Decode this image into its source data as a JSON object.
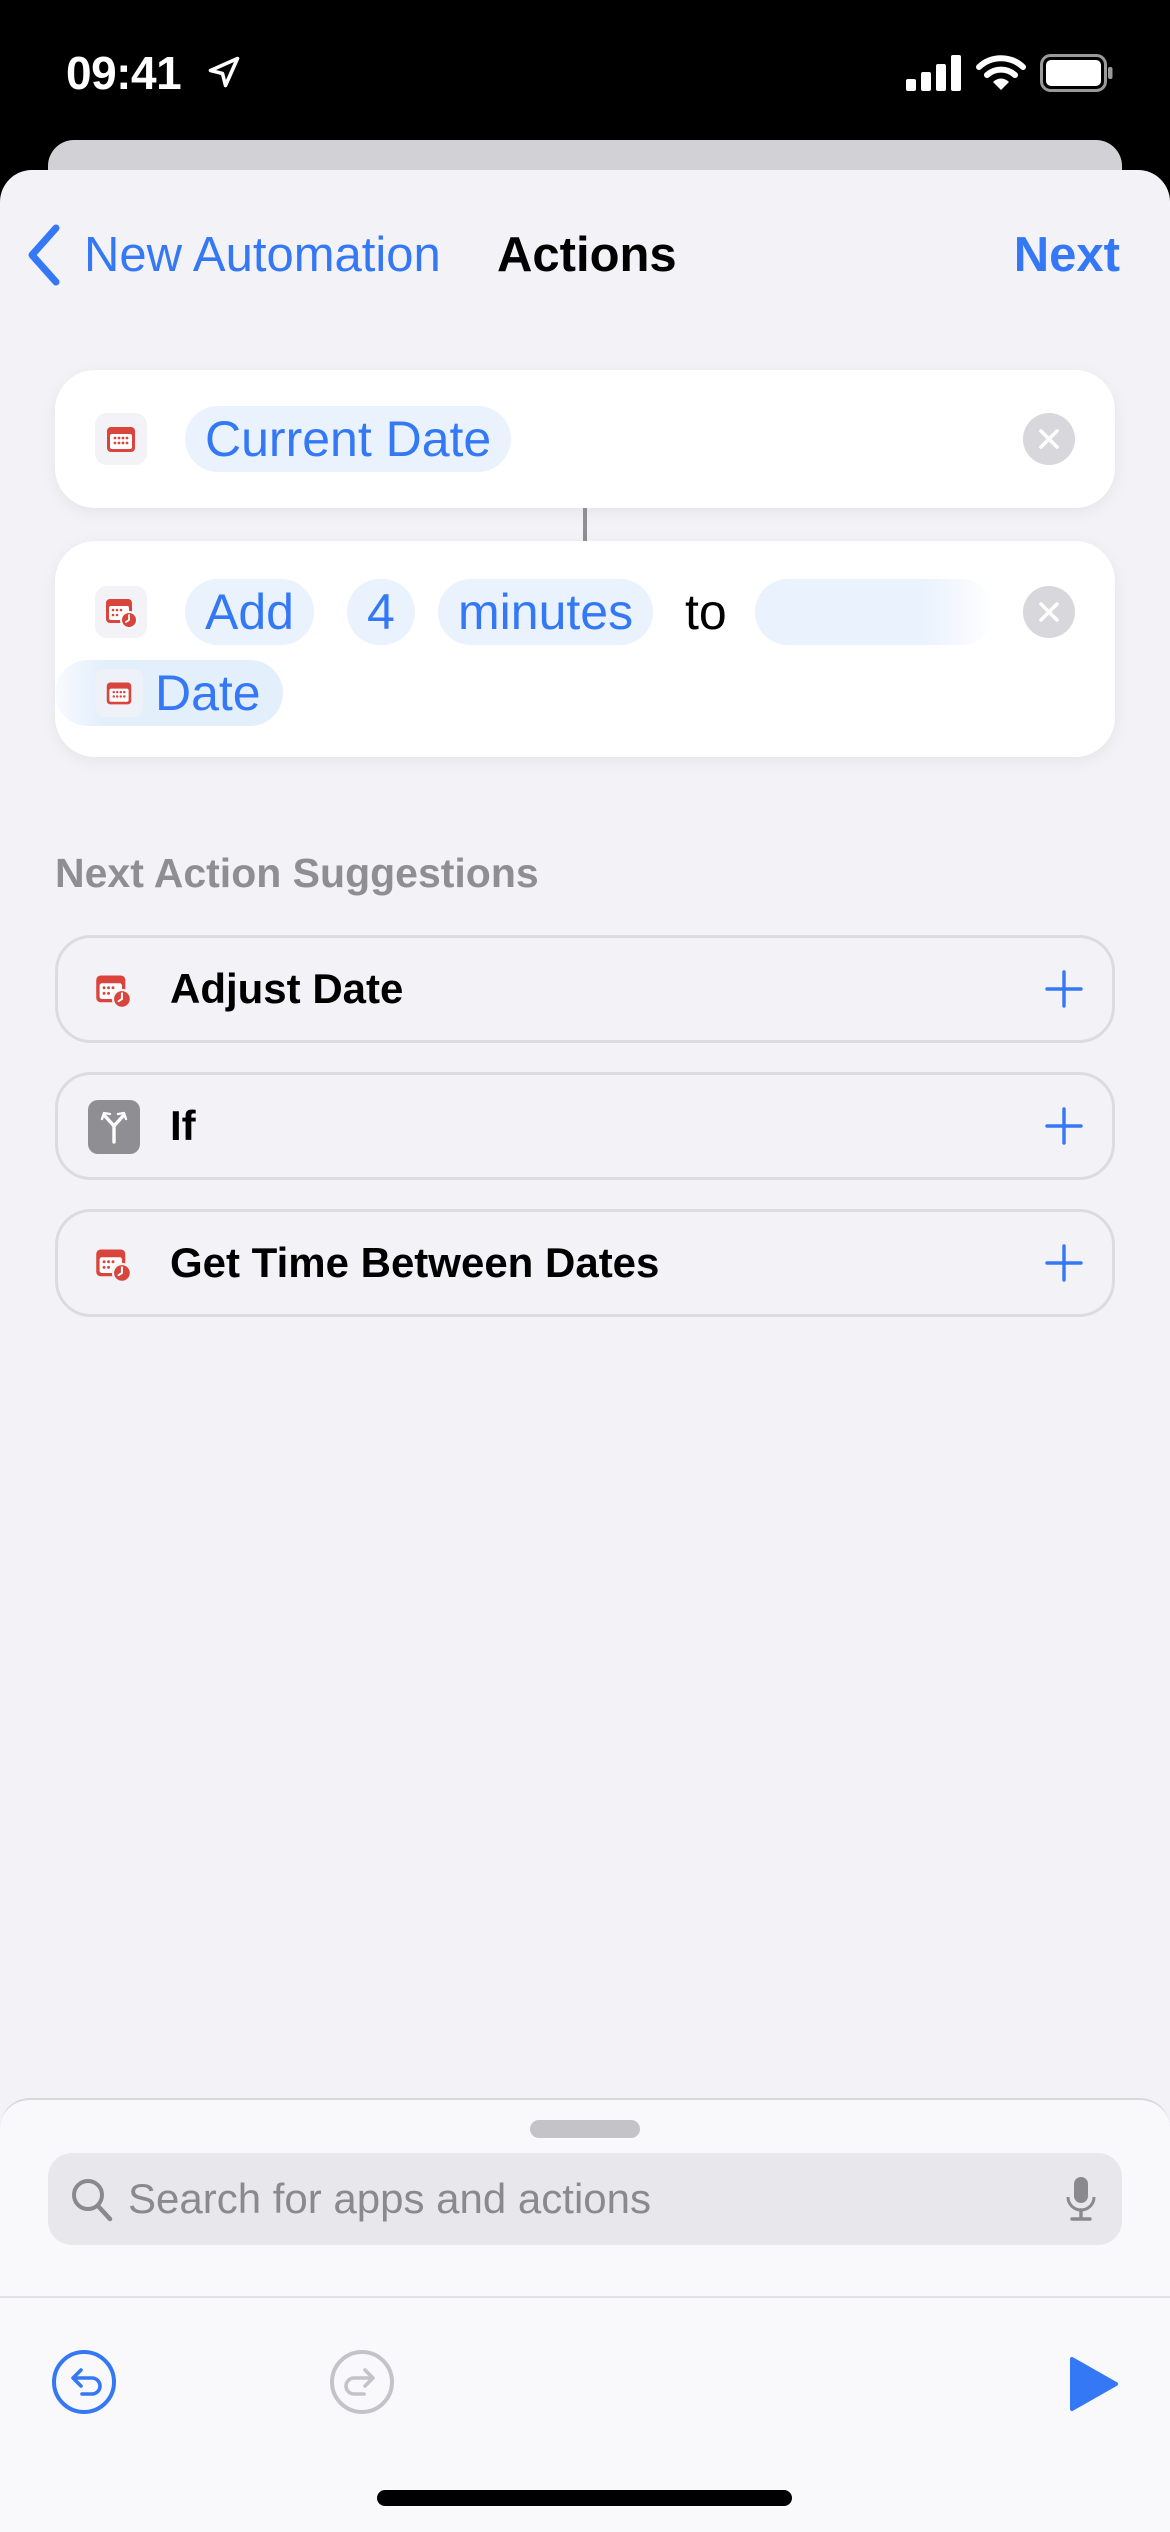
{
  "status_bar": {
    "time": "09:41",
    "icons": [
      "location-arrow-icon",
      "cellular-signal-icon",
      "wifi-icon",
      "battery-icon"
    ]
  },
  "nav": {
    "back_label": "New Automation",
    "title": "Actions",
    "next_label": "Next"
  },
  "actions": [
    {
      "icon": "calendar-icon",
      "tokens": [
        "Current Date"
      ]
    },
    {
      "icon": "calendar-clock-icon",
      "verb": "Add",
      "amount": "4",
      "unit": "minutes",
      "connector_word": "to",
      "target_label": "Date",
      "target_icon": "calendar-icon"
    }
  ],
  "suggestions": {
    "header": "Next Action Suggestions",
    "items": [
      {
        "label": "Adjust Date",
        "icon": "calendar-clock-icon"
      },
      {
        "label": "If",
        "icon": "branch-icon"
      },
      {
        "label": "Get Time Between Dates",
        "icon": "calendar-clock-icon"
      }
    ]
  },
  "search": {
    "placeholder": "Search for apps and actions"
  },
  "colors": {
    "accent": "#3478f6",
    "calendar_red": "#d9453c",
    "background": "#f2f2f7"
  }
}
